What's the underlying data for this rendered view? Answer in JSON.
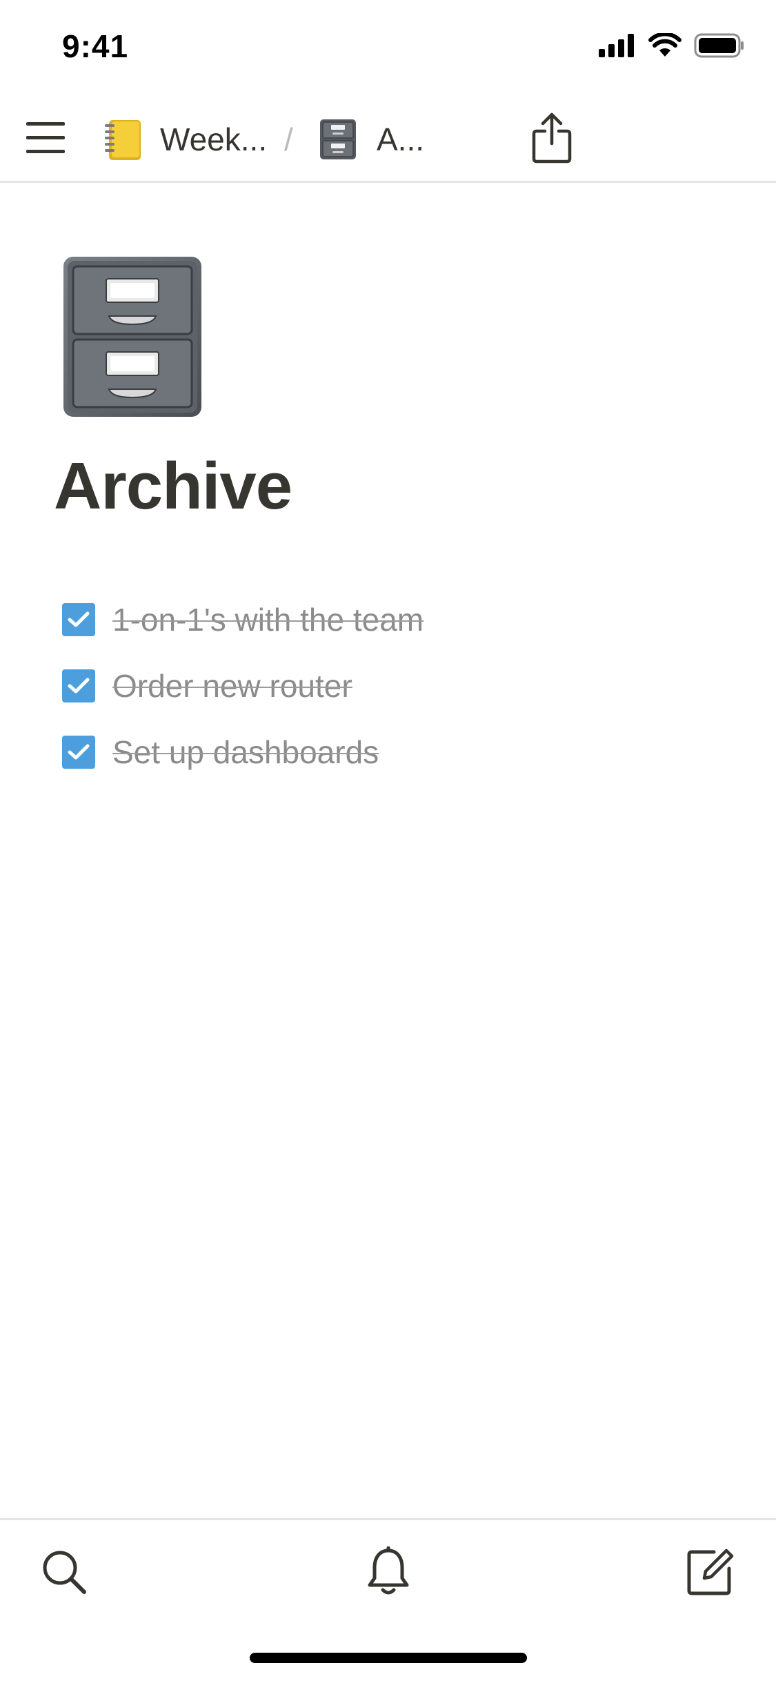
{
  "status_bar": {
    "time": "9:41",
    "icons": [
      "cellular-signal-icon",
      "wifi-icon",
      "battery-icon"
    ]
  },
  "nav": {
    "menu_icon": "hamburger-menu-icon",
    "breadcrumbs": [
      {
        "icon": "notebook-emoji-icon",
        "label": "Week..."
      },
      {
        "icon": "file-cabinet-emoji-icon",
        "label": "A..."
      }
    ],
    "separator": "/",
    "share_icon": "share-icon"
  },
  "page": {
    "icon": "file-cabinet-emoji-icon",
    "title": "Archive",
    "todos": [
      {
        "label": "1-on-1's with the team",
        "checked": true
      },
      {
        "label": "Order new router",
        "checked": true
      },
      {
        "label": "Set up dashboards",
        "checked": true
      }
    ]
  },
  "bottom_bar": {
    "icons": [
      "search-icon",
      "bell-icon",
      "compose-icon"
    ]
  },
  "colors": {
    "checkbox": "#4c9fdc",
    "title": "#37352f",
    "done_text": "#8b8b8b",
    "divider": "#e5e5e5"
  }
}
